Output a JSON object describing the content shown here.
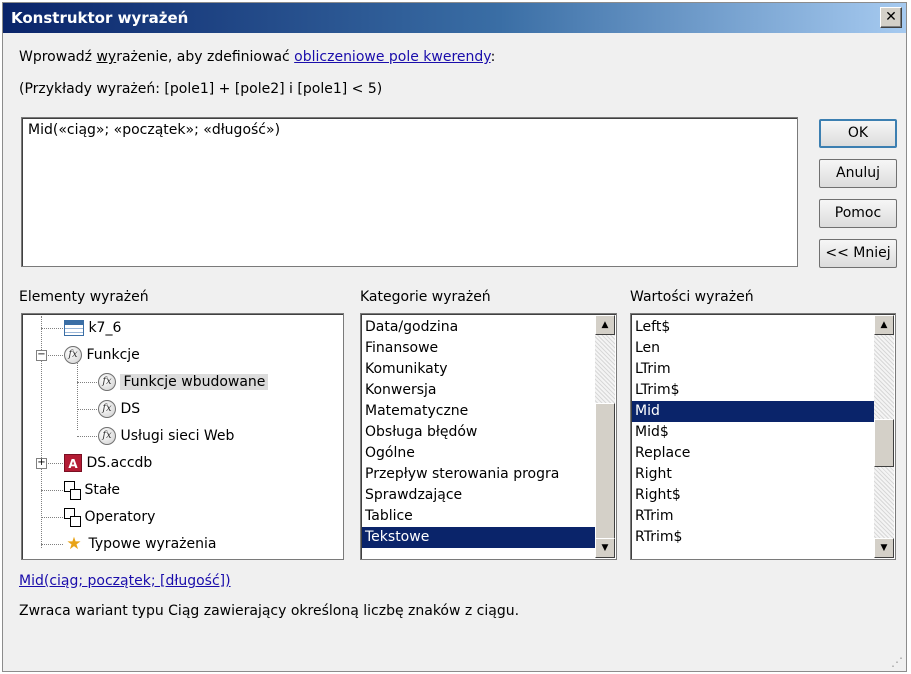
{
  "window": {
    "title": "Konstruktor wyrażeń",
    "close_label": "✕"
  },
  "intro": {
    "line1_prefix": "Wprowadź ",
    "line1_underlined": "wy",
    "line1_middle": "rażenie, aby zdefiniować ",
    "line1_link": "obliczeniowe pole kwerendy",
    "line1_suffix": ":",
    "line2": "(Przykłady wyrażeń: [pole1] + [pole2] i [pole1] < 5)"
  },
  "expression": {
    "value": "Mid(«ciąg»; «początek»; «długość»)"
  },
  "buttons": {
    "ok": "OK",
    "cancel": "Anuluj",
    "help": "Pomoc",
    "less": "<< Mniej"
  },
  "panes": {
    "elements_label": "Elementy wyrażeń",
    "categories_label": "Kategorie wyrażeń",
    "values_label": "Wartości wyrażeń"
  },
  "tree": [
    {
      "label": "k7_6",
      "icon": "table-icon"
    },
    {
      "label": "Funkcje",
      "icon": "function-icon",
      "expander": "−"
    },
    {
      "label": "Funkcje wbudowane",
      "icon": "function-icon",
      "selected": true
    },
    {
      "label": "DS",
      "icon": "function-icon"
    },
    {
      "label": "Usługi sieci Web",
      "icon": "function-icon"
    },
    {
      "label": "DS.accdb",
      "icon": "access-database-icon",
      "expander": "+",
      "icon_letter": "A"
    },
    {
      "label": "Stałe",
      "icon": "constants-icon"
    },
    {
      "label": "Operatory",
      "icon": "operators-icon"
    },
    {
      "label": "Typowe wyrażenia",
      "icon": "star-icon",
      "icon_glyph": "★"
    }
  ],
  "categories": [
    "Data/godzina",
    "Finansowe",
    "Komunikaty",
    "Konwersja",
    "Matematyczne",
    "Obsługa błędów",
    "Ogólne",
    "Przepływ sterowania progra",
    "Sprawdzające",
    "Tablice",
    "Tekstowe"
  ],
  "categories_selected": 10,
  "values": [
    "Left$",
    "Len",
    "LTrim",
    "LTrim$",
    "Mid",
    "Mid$",
    "Replace",
    "Right",
    "Right$",
    "RTrim",
    "RTrim$"
  ],
  "values_selected": 4,
  "scroll_glyphs": {
    "up": "▲",
    "down": "▼"
  },
  "footer": {
    "syntax_link": "Mid(ciąg; początek; [długość])",
    "description": "Zwraca wariant typu Ciąg zawierający określoną liczbę znaków z ciągu."
  },
  "colors": {
    "selection": "#0a246a",
    "link": "#1a0dab",
    "title_start": "#0a246a"
  }
}
